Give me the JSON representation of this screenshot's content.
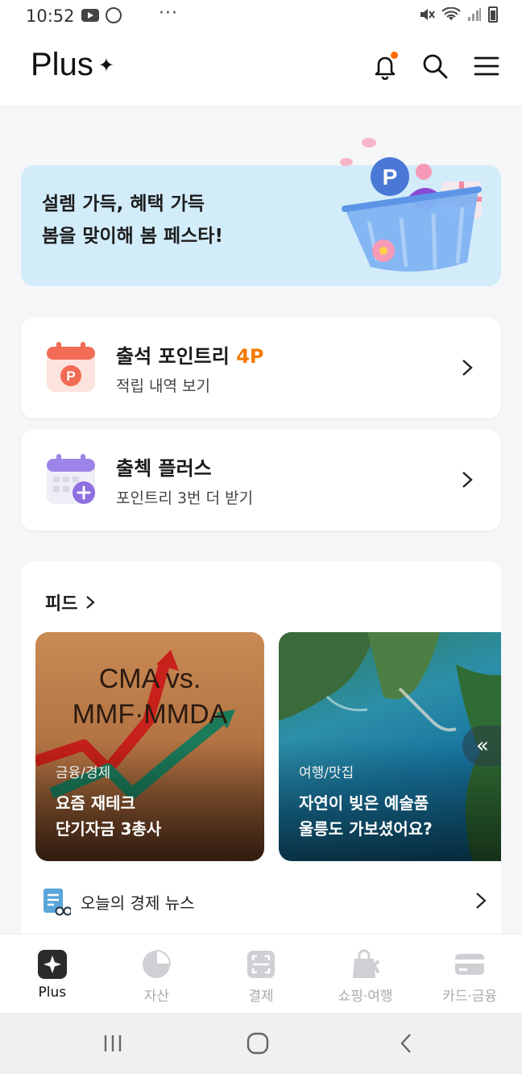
{
  "status_bar": {
    "time": "10:52",
    "more": "···"
  },
  "header": {
    "logo_text": "Plus",
    "logo_star": "✦"
  },
  "banner": {
    "line1": "설렘 가득, 혜택 가득",
    "line2": "봄을 맞이해 봄 페스타!"
  },
  "attendance": {
    "title": "출석 포인트리 ",
    "points": "4P",
    "subtitle": "적립 내역 보기"
  },
  "attendance_plus": {
    "title": "출첵 플러스",
    "subtitle": "포인트리 3번 더 받기"
  },
  "feed": {
    "heading": "피드",
    "cards": [
      {
        "art_line1": "CMA vs.",
        "art_line2": "MMF·MMDA",
        "category": "금융/경제",
        "title_line1": "요즘 재테크",
        "title_line2": "단기자금 3총사"
      },
      {
        "category": "여행/맛집",
        "title_line1": "자연이 빚은 예술품",
        "title_line2": "울릉도 가보셨어요?"
      }
    ],
    "prev_glyph": "«",
    "news_label": "오늘의 경제 뉴스"
  },
  "tabbar": {
    "tabs": [
      {
        "label": "Plus",
        "icon": "plus-star-icon"
      },
      {
        "label": "자산",
        "icon": "pie-chart-icon"
      },
      {
        "label": "결제",
        "icon": "scan-icon"
      },
      {
        "label": "쇼핑·여행",
        "icon": "shopping-bag-icon"
      },
      {
        "label": "카드·금융",
        "icon": "card-icon"
      }
    ]
  },
  "colors": {
    "accent_orange": "#f47b00",
    "banner_bg": "#d2ecfa",
    "notification_dot": "#ff6a00"
  }
}
